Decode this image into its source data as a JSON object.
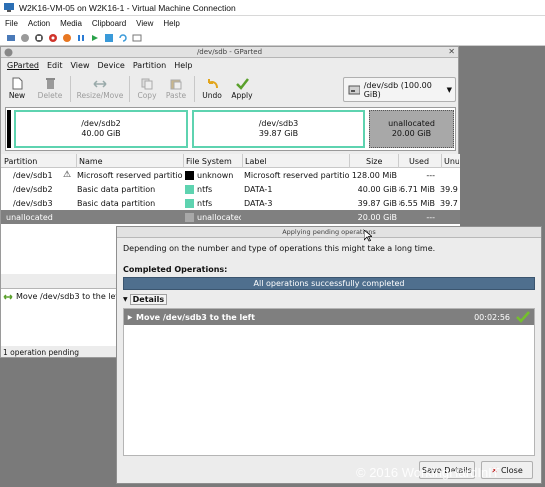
{
  "host": {
    "title": "W2K16-VM-05 on W2K16-1 - Virtual Machine Connection",
    "menu": [
      "File",
      "Action",
      "Media",
      "Clipboard",
      "View",
      "Help"
    ]
  },
  "gparted": {
    "title": "/dev/sdb - GParted",
    "menu": [
      "GParted",
      "Edit",
      "View",
      "Device",
      "Partition",
      "Help"
    ],
    "toolbar": {
      "new": "New",
      "delete": "Delete",
      "resize": "Resize/Move",
      "copy": "Copy",
      "paste": "Paste",
      "undo": "Undo",
      "apply": "Apply"
    },
    "device": "/dev/sdb  (100.00 GiB)",
    "map": [
      {
        "name": "/dev/sdb2",
        "size": "40.00 GiB"
      },
      {
        "name": "/dev/sdb3",
        "size": "39.87 GiB"
      },
      {
        "name": "unallocated",
        "size": "20.00 GiB"
      }
    ],
    "columns": [
      "Partition",
      "Name",
      "File System",
      "Label",
      "Size",
      "Used",
      "Unu"
    ],
    "rows": [
      {
        "partition": "/dev/sdb1",
        "name": "Microsoft reserved partition",
        "fs": "unknown",
        "label": "Microsoft reserved partition",
        "size": "128.00 MiB",
        "used": "---",
        "unused": ""
      },
      {
        "partition": "/dev/sdb2",
        "name": "Basic data partition",
        "fs": "ntfs",
        "label": "DATA-1",
        "size": "40.00 GiB",
        "used": "86.71 MiB",
        "unused": "39.9"
      },
      {
        "partition": "/dev/sdb3",
        "name": "Basic data partition",
        "fs": "ntfs",
        "label": "DATA-3",
        "size": "39.87 GiB",
        "used": "86.55 MiB",
        "unused": "39.7"
      },
      {
        "partition": "unallocated",
        "name": "",
        "fs": "unallocated",
        "label": "",
        "size": "20.00 GiB",
        "used": "---",
        "unused": ""
      }
    ],
    "operation": "Move /dev/sdb3 to the left",
    "status": "1 operation pending",
    "colors": {
      "ntfs": "#5ed3b0",
      "unknown": "#000000",
      "unallocated": "#a8a8a8",
      "selection": "#808080"
    }
  },
  "dialog": {
    "title": "Applying pending operations",
    "description": "Depending on the number and type of operations this might take a long time.",
    "completed_label": "Completed Operations:",
    "progress_text": "All operations successfully completed",
    "details_label": "Details",
    "operation": "Move /dev/sdb3 to the left",
    "elapsed": "00:02:56",
    "save_details": "Save Details",
    "close": "Close"
  },
  "watermark": "© 2016 WorkingHardInIT"
}
